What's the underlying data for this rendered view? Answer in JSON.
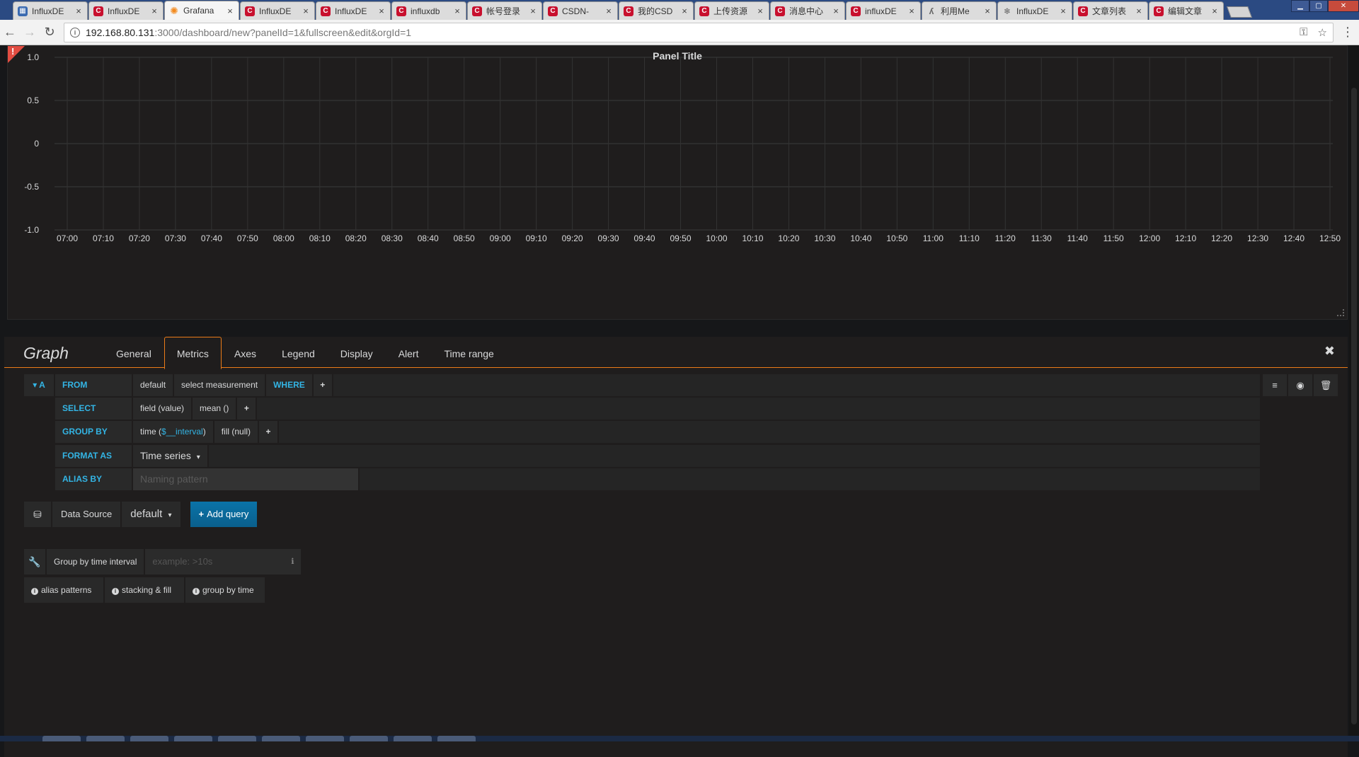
{
  "browser": {
    "tabs": [
      {
        "label": "InfluxDE",
        "favicon": "db-icon"
      },
      {
        "label": "InfluxDE",
        "favicon": "csdn-icon"
      },
      {
        "label": "Grafana",
        "favicon": "grafana-icon",
        "active": true
      },
      {
        "label": "InfluxDE",
        "favicon": "csdn-icon"
      },
      {
        "label": "InfluxDE",
        "favicon": "csdn-icon"
      },
      {
        "label": "influxdb",
        "favicon": "csdn-icon"
      },
      {
        "label": "帐号登录",
        "favicon": "csdn-icon"
      },
      {
        "label": "CSDN-",
        "favicon": "csdn-icon"
      },
      {
        "label": "我的CSD",
        "favicon": "csdn-icon"
      },
      {
        "label": "上传资源",
        "favicon": "csdn-icon"
      },
      {
        "label": "消息中心",
        "favicon": "csdn-icon"
      },
      {
        "label": "influxDE",
        "favicon": "csdn-icon"
      },
      {
        "label": "利用Me",
        "favicon": "web-icon"
      },
      {
        "label": "InfluxDE",
        "favicon": "snow-icon"
      },
      {
        "label": "文章列表",
        "favicon": "csdn-icon"
      },
      {
        "label": "编辑文章",
        "favicon": "csdn-icon"
      }
    ],
    "url_host": "192.168.80.131",
    "url_rest": ":3000/dashboard/new?panelId=1&fullscreen&edit&orgId=1"
  },
  "panel": {
    "title": "Panel Title",
    "alert_mark": "!"
  },
  "chart_data": {
    "type": "line",
    "title": "Panel Title",
    "series": [],
    "ylim": [
      -1.0,
      1.0
    ],
    "yticks": [
      "1.0",
      "0.5",
      "0",
      "-0.5",
      "-1.0"
    ],
    "xticks": [
      "07:00",
      "07:10",
      "07:20",
      "07:30",
      "07:40",
      "07:50",
      "08:00",
      "08:10",
      "08:20",
      "08:30",
      "08:40",
      "08:50",
      "09:00",
      "09:10",
      "09:20",
      "09:30",
      "09:40",
      "09:50",
      "10:00",
      "10:10",
      "10:20",
      "10:30",
      "10:40",
      "10:50",
      "11:00",
      "11:10",
      "11:20",
      "11:30",
      "11:40",
      "11:50",
      "12:00",
      "12:10",
      "12:20",
      "12:30",
      "12:40",
      "12:50"
    ],
    "grid": true
  },
  "editor": {
    "title": "Graph",
    "tabs": [
      "General",
      "Metrics",
      "Axes",
      "Legend",
      "Display",
      "Alert",
      "Time range"
    ],
    "active_tab": "Metrics",
    "close": "✖",
    "query": {
      "ref_id": "A",
      "from_label": "FROM",
      "policy": "default",
      "measurement": "select measurement",
      "where_label": "WHERE",
      "select_label": "SELECT",
      "field": "field (value)",
      "aggregate": "mean ()",
      "group_by_label": "GROUP BY",
      "time_prefix": "time (",
      "time_interval": "$__interval",
      "time_suffix": ")",
      "fill": "fill (null)",
      "format_as_label": "FORMAT AS",
      "format_value": "Time series",
      "alias_by_label": "ALIAS BY",
      "alias_placeholder": "Naming pattern",
      "plus": "+"
    },
    "datasource": {
      "label": "Data Source",
      "value": "default",
      "add_query": "Add query"
    },
    "options": {
      "group_by_time_label": "Group by time interval",
      "group_by_time_placeholder": "example: >10s",
      "help": [
        "alias patterns",
        "stacking & fill",
        "group by time"
      ]
    }
  },
  "colors": {
    "accent_blue": "#33b5e5",
    "accent_orange": "#eb7b18",
    "alert_red": "#e24d42",
    "panel_bg": "#1f1d1d",
    "page_bg": "#161719"
  }
}
